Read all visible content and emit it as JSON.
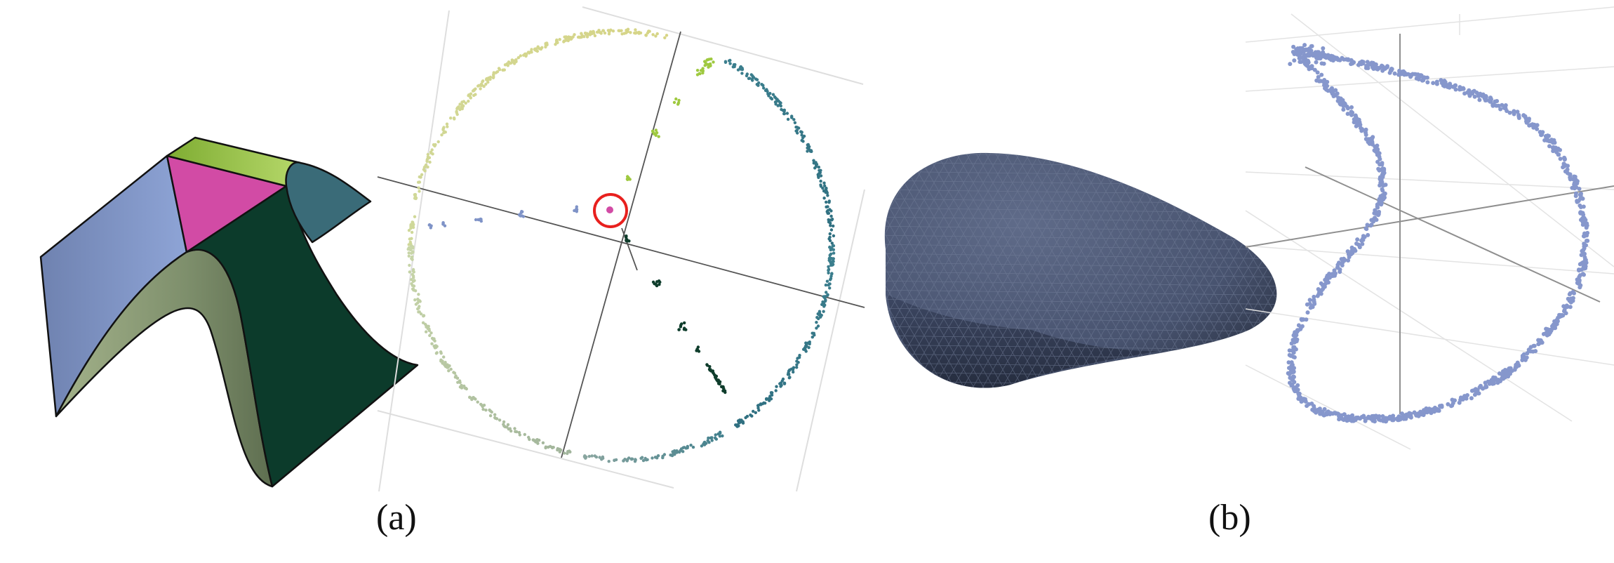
{
  "figure": {
    "panels": [
      {
        "id": "a",
        "caption": "(a)",
        "views": [
          "surface-patch-model",
          "normal-gauss-map-scatter"
        ],
        "colors": {
          "blue_face": "#7b8dbd",
          "green_strip": "#9cc64a",
          "magenta_face": "#d24ba5",
          "teal_face": "#3a6b78",
          "dark_green_face": "#0c3b2b",
          "olive_face": "#8a9a76",
          "highlight_circle": "#e8201e"
        }
      },
      {
        "id": "b",
        "caption": "(b)",
        "views": [
          "smooth-meshed-surface",
          "point-curve-scatter"
        ],
        "colors": {
          "mesh_surface": "#4c5772",
          "mesh_lines": "#6f7a95",
          "curve_points": "#8697cc",
          "grid": "#dddddd"
        }
      }
    ]
  }
}
